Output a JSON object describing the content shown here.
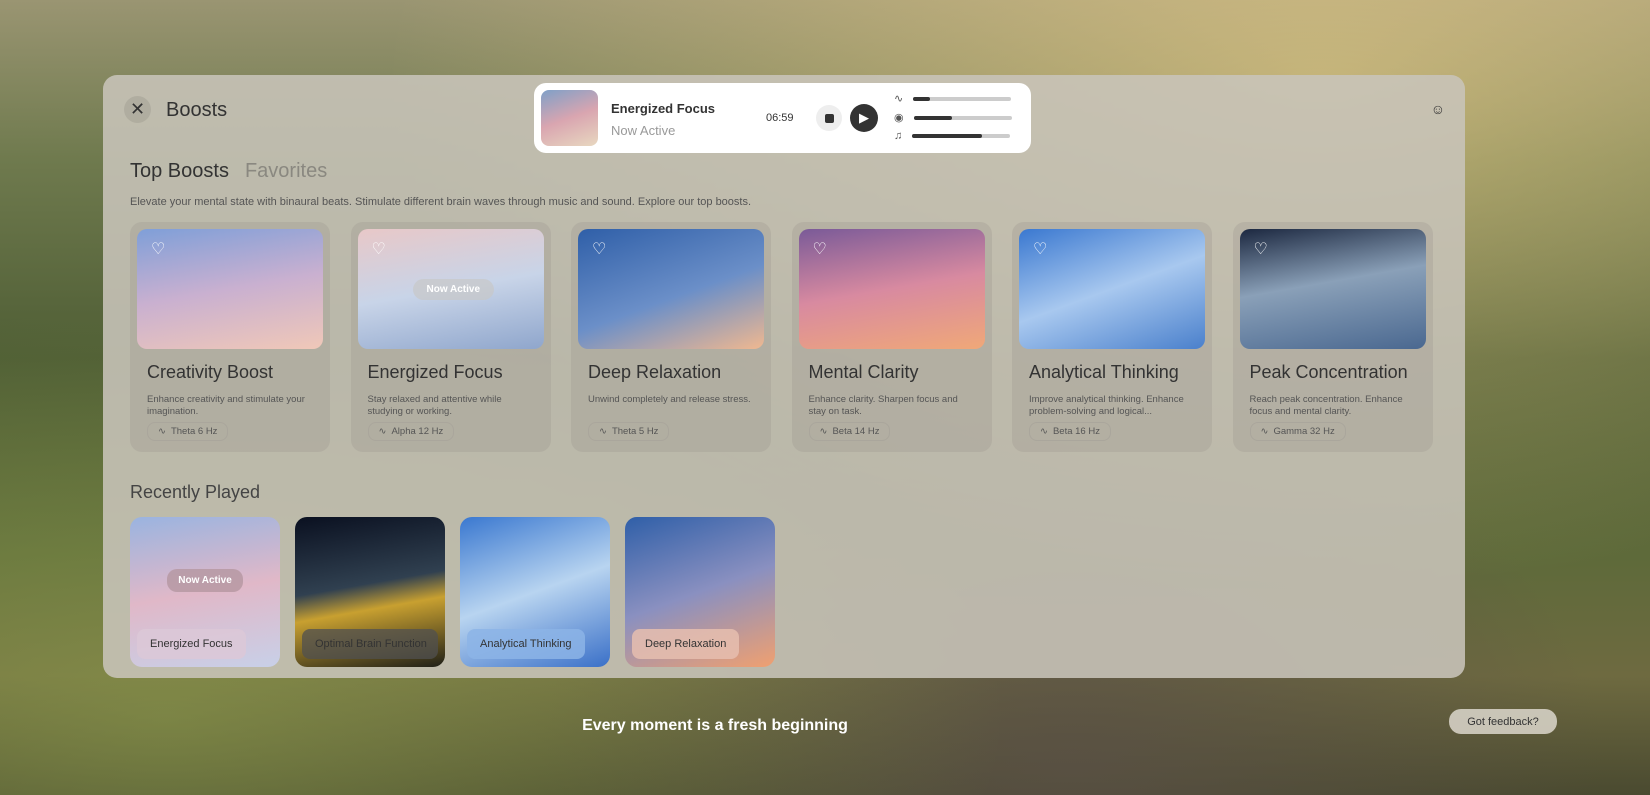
{
  "header": {
    "title": "Boosts"
  },
  "player": {
    "title": "Energized Focus",
    "status": "Now Active",
    "time": "06:59",
    "sliders": [
      {
        "icon": "waveform-icon",
        "value": 0.17
      },
      {
        "icon": "target-icon",
        "value": 0.39
      },
      {
        "icon": "music-icon",
        "value": 0.71
      }
    ]
  },
  "tabs": [
    "Top Boosts",
    "Favorites"
  ],
  "description": "Elevate your mental state with binaural beats. Stimulate different brain waves through music and sound. Explore our top boosts.",
  "boosts": [
    {
      "name": "Creativity Boost",
      "desc": "Enhance creativity and stimulate your imagination.",
      "freq": "Theta 6 Hz"
    },
    {
      "name": "Energized Focus",
      "desc": "Stay relaxed and attentive while studying or working.",
      "freq": "Alpha 12 Hz",
      "badge": "Now Active"
    },
    {
      "name": "Deep Relaxation",
      "desc": "Unwind completely and release stress.",
      "freq": "Theta 5 Hz"
    },
    {
      "name": "Mental Clarity",
      "desc": "Enhance clarity. Sharpen focus and stay on task.",
      "freq": "Beta 14 Hz"
    },
    {
      "name": "Analytical Thinking",
      "desc": "Improve analytical thinking. Enhance problem-solving and logical...",
      "freq": "Beta 16 Hz"
    },
    {
      "name": "Peak Concentration",
      "desc": "Reach peak concentration. Enhance focus and mental clarity.",
      "freq": "Gamma 32 Hz"
    }
  ],
  "recent": {
    "title": "Recently Played",
    "items": [
      {
        "name": "Energized Focus",
        "badge": "Now Active"
      },
      {
        "name": "Optimal Brain Function"
      },
      {
        "name": "Analytical Thinking"
      },
      {
        "name": "Deep Relaxation"
      }
    ]
  },
  "motto": "Every moment is a fresh beginning",
  "feedback": "Got feedback?"
}
